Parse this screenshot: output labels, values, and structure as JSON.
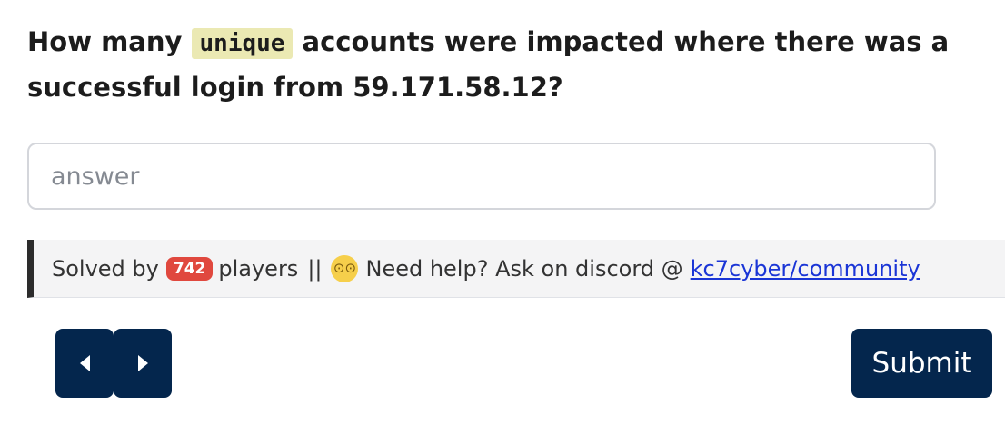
{
  "question": {
    "prefix": "How many ",
    "highlight": "unique",
    "suffix": " accounts were impacted where there was a successful login from 59.171.58.12?"
  },
  "answer": {
    "placeholder": "answer",
    "value": ""
  },
  "info": {
    "solved_prefix": "Solved by",
    "solved_count": "742",
    "solved_suffix": "players",
    "separator": "||",
    "emoji": "woozy-face-emoji",
    "help_text": "Need help? Ask on discord @",
    "link_text": "kc7cyber/community"
  },
  "nav": {
    "prev_icon": "caret-left-icon",
    "next_icon": "caret-right-icon"
  },
  "submit_label": "Submit",
  "colors": {
    "primary": "#04264d",
    "badge": "#e0483e",
    "highlight": "#ebe9b3",
    "link": "#1a35d6"
  }
}
